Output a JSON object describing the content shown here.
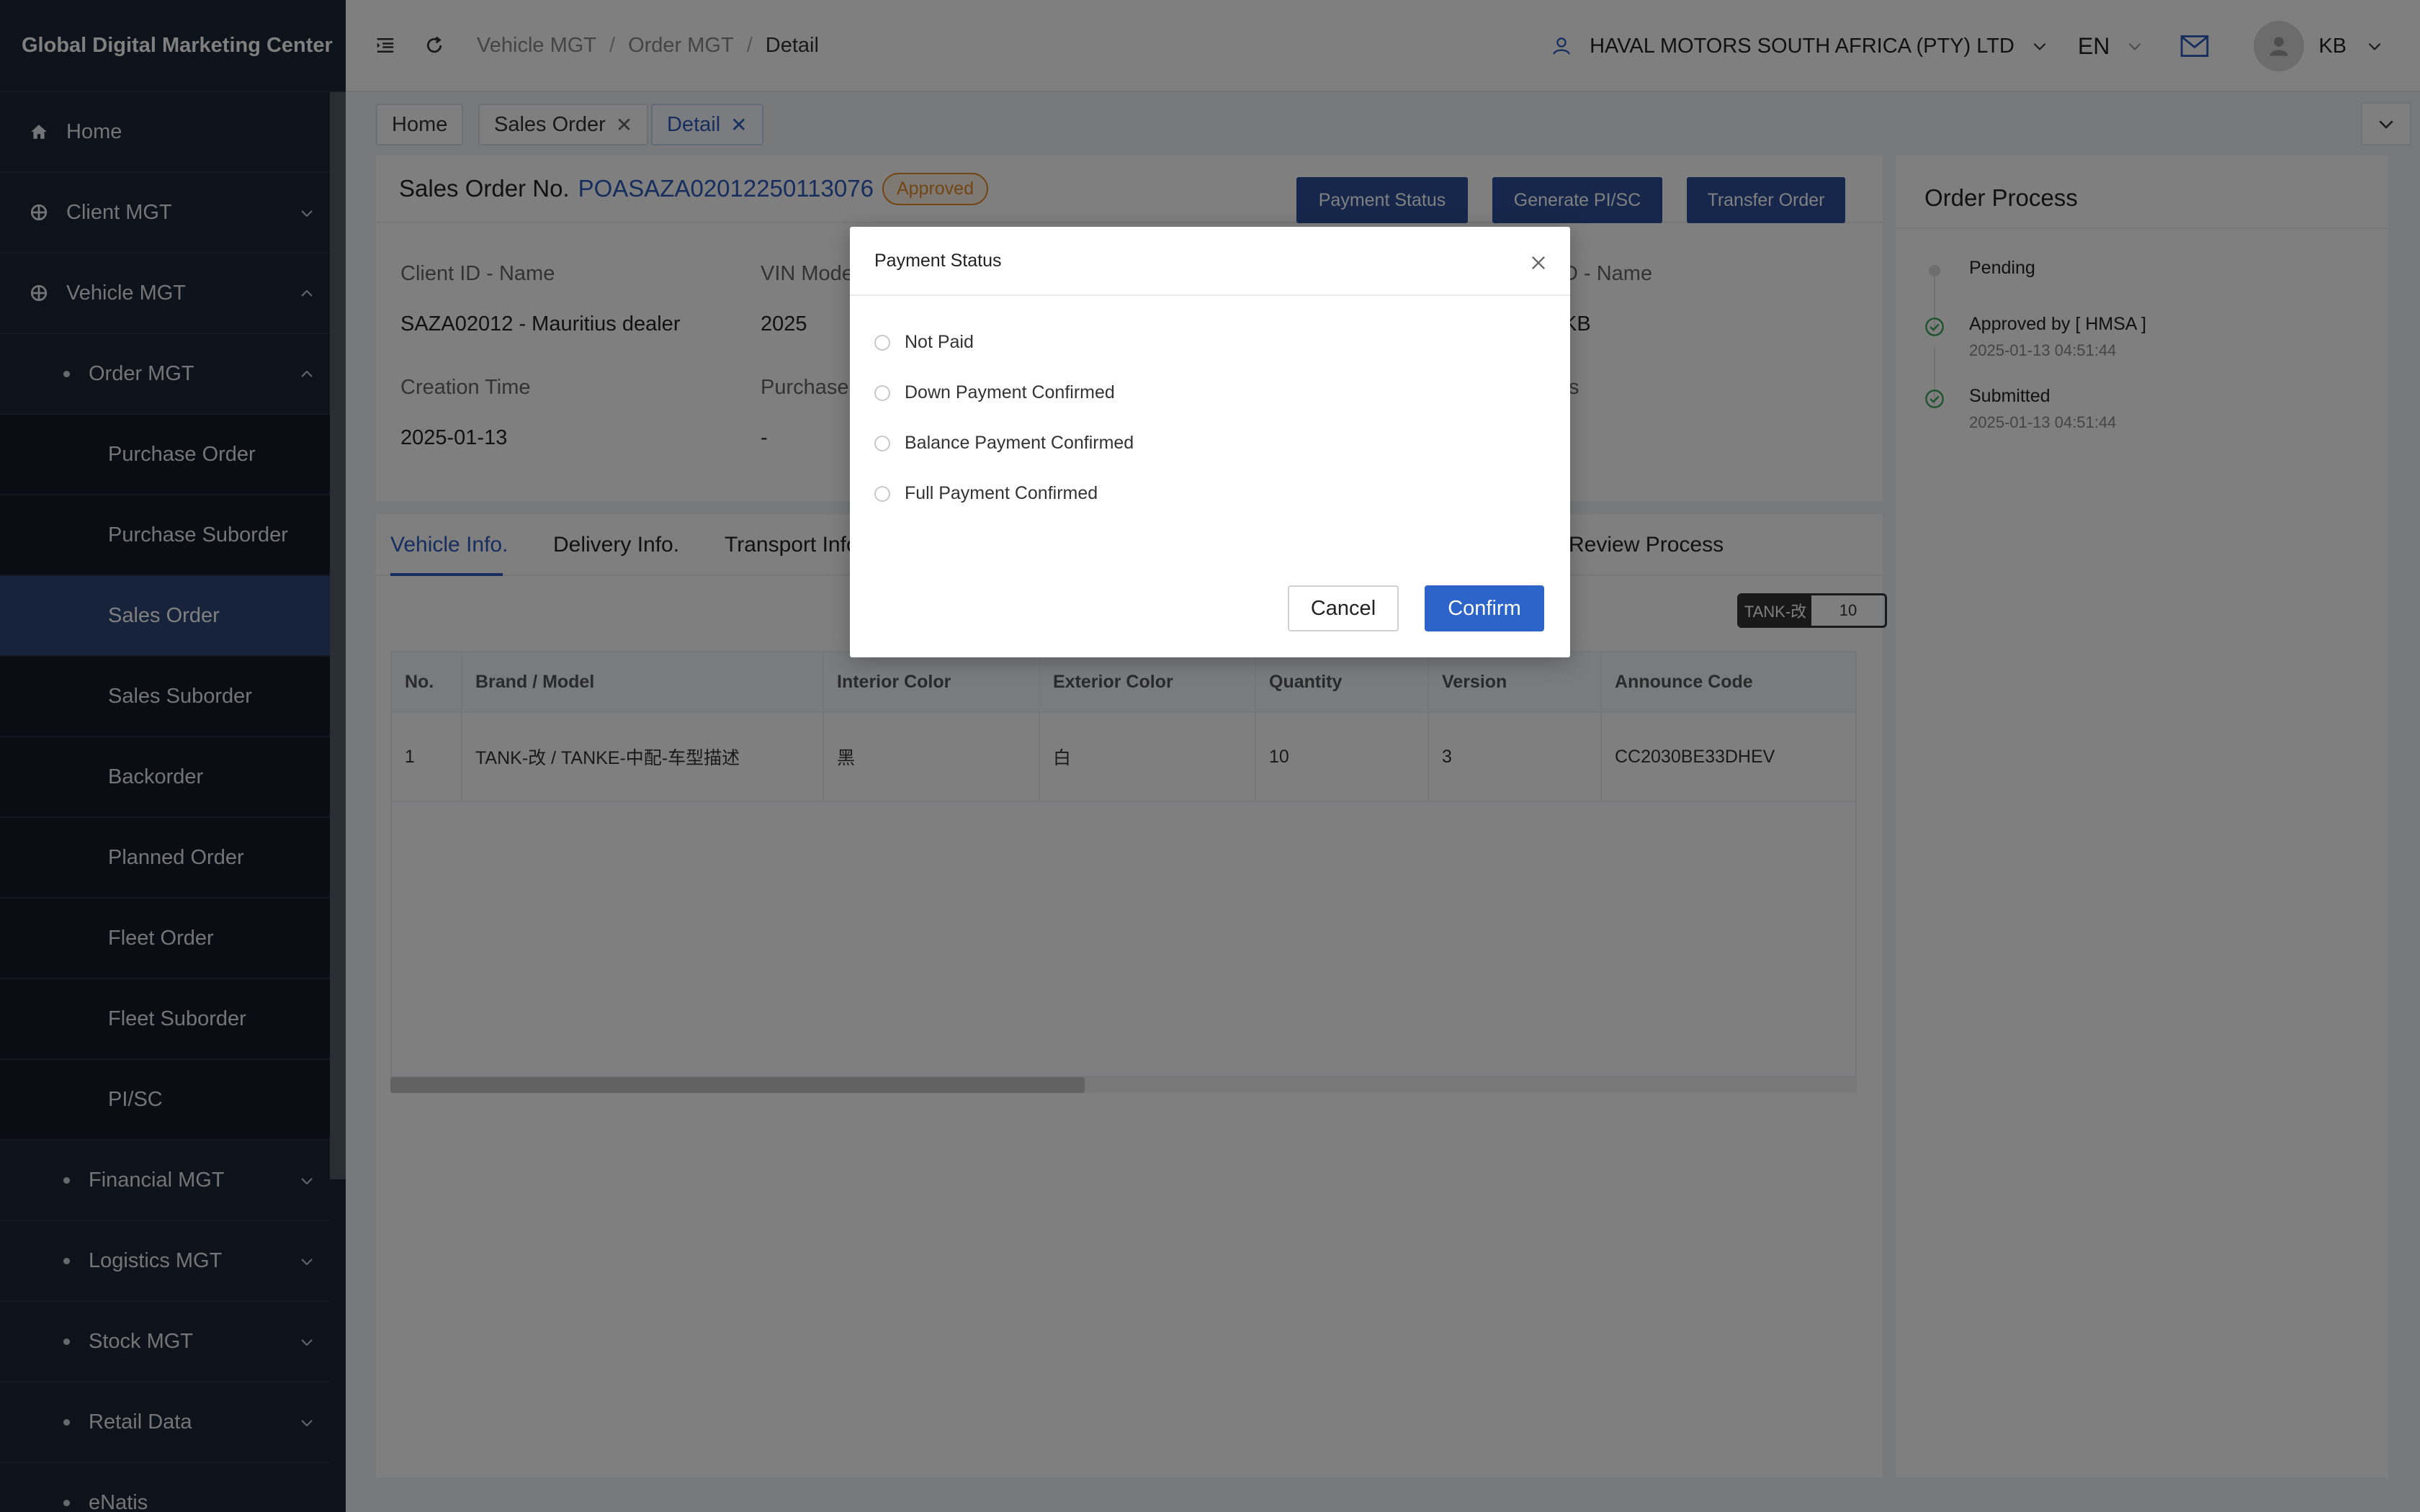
{
  "sidebar": {
    "brand": "Global Digital Marketing Center",
    "items": {
      "home": "Home",
      "client_mgt": "Client MGT",
      "vehicle_mgt": "Vehicle MGT",
      "order_mgt": "Order MGT",
      "purchase_order": "Purchase Order",
      "purchase_suborder": "Purchase Suborder",
      "sales_order": "Sales Order",
      "sales_suborder": "Sales Suborder",
      "backorder": "Backorder",
      "planned_order": "Planned Order",
      "fleet_order": "Fleet Order",
      "fleet_suborder": "Fleet Suborder",
      "pisc": "PI/SC",
      "financial_mgt": "Financial MGT",
      "logistics_mgt": "Logistics MGT",
      "stock_mgt": "Stock MGT",
      "retail_data": "Retail Data",
      "enatis": "eNatis"
    }
  },
  "header": {
    "breadcrumb": [
      "Vehicle MGT",
      "Order MGT",
      "Detail"
    ],
    "breadcrumb_sep": "/",
    "company": "HAVAL MOTORS SOUTH AFRICA (PTY) LTD",
    "language": "EN",
    "user": "KB"
  },
  "tags": {
    "home": "Home",
    "sales_order": "Sales Order",
    "detail": "Detail",
    "close_glyph": "✕"
  },
  "order": {
    "label": "Sales Order No.",
    "number": "POASAZA02012250113076",
    "status": "Approved",
    "buttons": {
      "payment_status": "Payment Status",
      "generate": "Generate PI/SC",
      "transfer": "Transfer Order"
    },
    "fields": {
      "client_label": "Client ID - Name",
      "client_value": "SAZA02012 - Mauritius dealer",
      "vin_label": "VIN Mode",
      "vin_value": "2025",
      "right_label": "D - Name",
      "right_value": "KB",
      "creation_label": "Creation Time",
      "creation_value": "2025-01-13",
      "purchase_label": "Purchase",
      "purchase_value": "-",
      "right2_label": "ts"
    }
  },
  "tabs": {
    "vehicle": "Vehicle Info.",
    "delivery": "Delivery Info.",
    "transport": "Transport Info",
    "review": "Review Process"
  },
  "toggle": {
    "left": "TANK-改",
    "right": "10"
  },
  "table": {
    "headers": [
      "No.",
      "Brand / Model",
      "Interior Color",
      "Exterior Color",
      "Quantity",
      "Version",
      "Announce Code"
    ],
    "rows": [
      [
        "1",
        "TANK-改 / TANKE-中配-车型描述",
        "黑",
        "白",
        "10",
        "3",
        "CC2030BE33DHEV"
      ]
    ]
  },
  "process": {
    "title": "Order Process",
    "steps": [
      {
        "text": "Pending",
        "time": ""
      },
      {
        "text": "Approved by [ HMSA ]",
        "time": "2025-01-13 04:51:44"
      },
      {
        "text": "Submitted",
        "time": "2025-01-13 04:51:44"
      }
    ]
  },
  "modal": {
    "title": "Payment Status",
    "options": [
      "Not Paid",
      "Down Payment Confirmed",
      "Balance Payment Confirmed",
      "Full Payment Confirmed"
    ],
    "cancel": "Cancel",
    "confirm": "Confirm"
  },
  "colors": {
    "sidebar_bg": "#1c2434",
    "sidebar_active": "#2e4676",
    "primary": "#2c4f96",
    "link": "#2d5bbd",
    "status_approved": "#e58b2a",
    "success": "#3aa55c"
  },
  "icons": {
    "menu_toggle": "menu-fold-icon",
    "refresh": "refresh-icon",
    "user": "user-icon",
    "mail": "mail-icon",
    "close": "close-icon"
  }
}
